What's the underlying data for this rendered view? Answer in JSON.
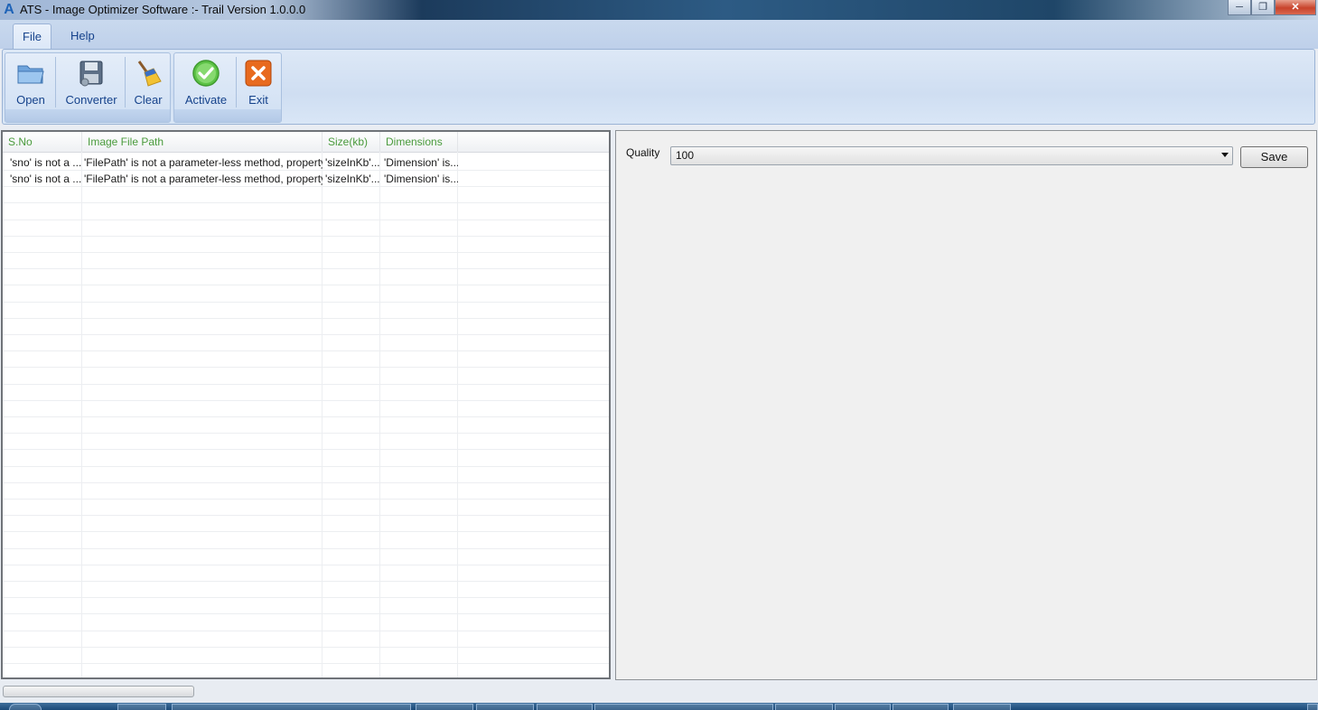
{
  "window": {
    "title": "ATS - Image Optimizer Software :- Trail Version 1.0.0.0",
    "logo": "A",
    "minimize_icon": "minimize-icon",
    "maximize_icon": "maximize-icon",
    "close_icon": "close-icon"
  },
  "menu": {
    "tabs": [
      {
        "label": "File",
        "active": true
      },
      {
        "label": "Help",
        "active": false
      }
    ]
  },
  "ribbon": {
    "buttons": [
      {
        "label": "Open",
        "icon": "folder-open-icon"
      },
      {
        "label": "Converter",
        "icon": "floppy-disk-icon"
      },
      {
        "label": "Clear",
        "icon": "broom-icon"
      },
      {
        "label": "Activate",
        "icon": "green-check-icon"
      },
      {
        "label": "Exit",
        "icon": "red-x-icon"
      }
    ]
  },
  "grid": {
    "columns": [
      "S.No",
      "Image File Path",
      "Size(kb)",
      "Dimensions"
    ],
    "rows": [
      [
        "'sno' is not a ...",
        "'FilePath' is not a parameter-less method, property...",
        "'sizeInKb'...",
        "'Dimension' is..."
      ],
      [
        "'sno' is not a ...",
        "'FilePath' is not a parameter-less method, property...",
        "'sizeInKb'...",
        "'Dimension' is..."
      ]
    ]
  },
  "settings": {
    "quality_label": "Quality",
    "quality_value": "100",
    "save_label": "Save"
  },
  "colors": {
    "header_text": "#4a9b3c",
    "ribbon_text": "#15428b"
  }
}
